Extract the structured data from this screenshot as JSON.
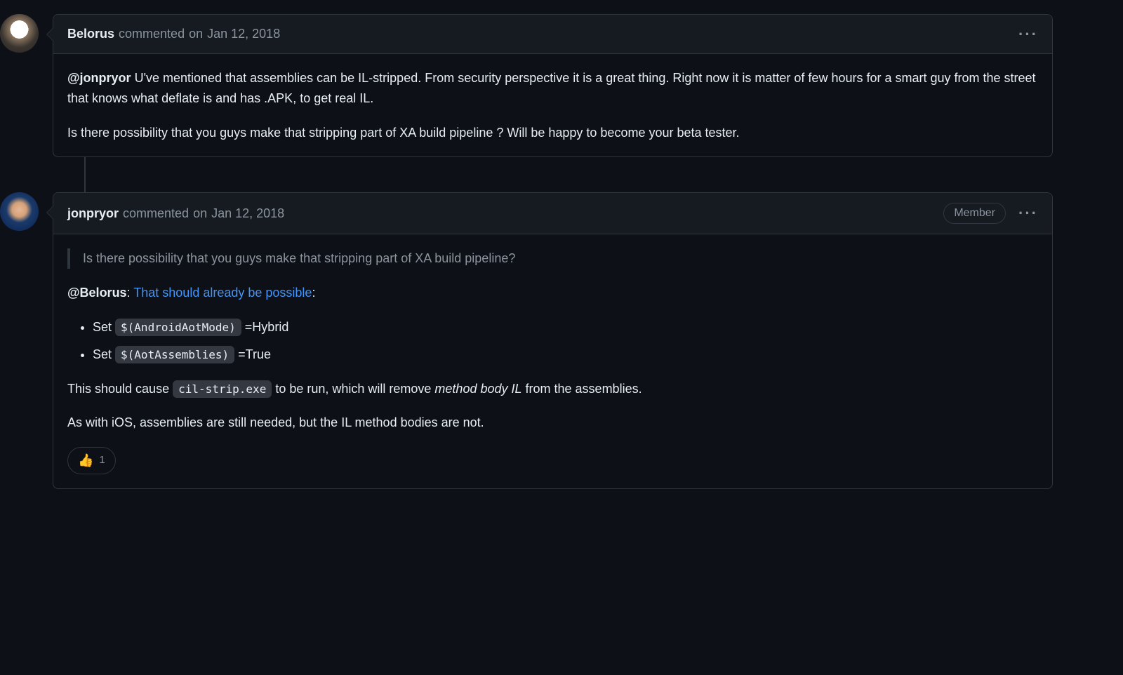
{
  "comments": [
    {
      "author": "Belorus",
      "commented": "commented",
      "on": "on",
      "date": "Jan 12, 2018",
      "badge": null,
      "body": {
        "p1": {
          "mention": "@jonpryor",
          "rest": " U've mentioned that assemblies can be IL-stripped. From security perspective it is a great thing. Right now it is matter of few hours for a smart guy from the street that knows what deflate is and has .APK, to get real IL."
        },
        "p2": "Is there possibility that you guys make that stripping part of XA build pipeline ? Will be happy to become your beta tester."
      }
    },
    {
      "author": "jonpryor",
      "commented": "commented",
      "on": "on",
      "date": "Jan 12, 2018",
      "badge": "Member",
      "body": {
        "quote": "Is there possibility that you guys make that stripping part of XA build pipeline?",
        "p1": {
          "mention": "@Belorus",
          "afterMention": ": ",
          "link": "That should already be possible",
          "afterLink": ":"
        },
        "list": [
          {
            "pre": "Set ",
            "code": "$(AndroidAotMode)",
            "post": " =Hybrid"
          },
          {
            "pre": "Set ",
            "code": "$(AotAssemblies)",
            "post": " =True"
          }
        ],
        "p2": {
          "t1": "This should cause ",
          "code": "cil-strip.exe",
          "t2": " to be run, which will remove ",
          "em": "method body IL",
          "t3": " from the assemblies."
        },
        "p3": "As with iOS, assemblies are still needed, but the IL method bodies are not."
      },
      "reaction": {
        "emoji": "👍",
        "count": "1"
      }
    }
  ]
}
